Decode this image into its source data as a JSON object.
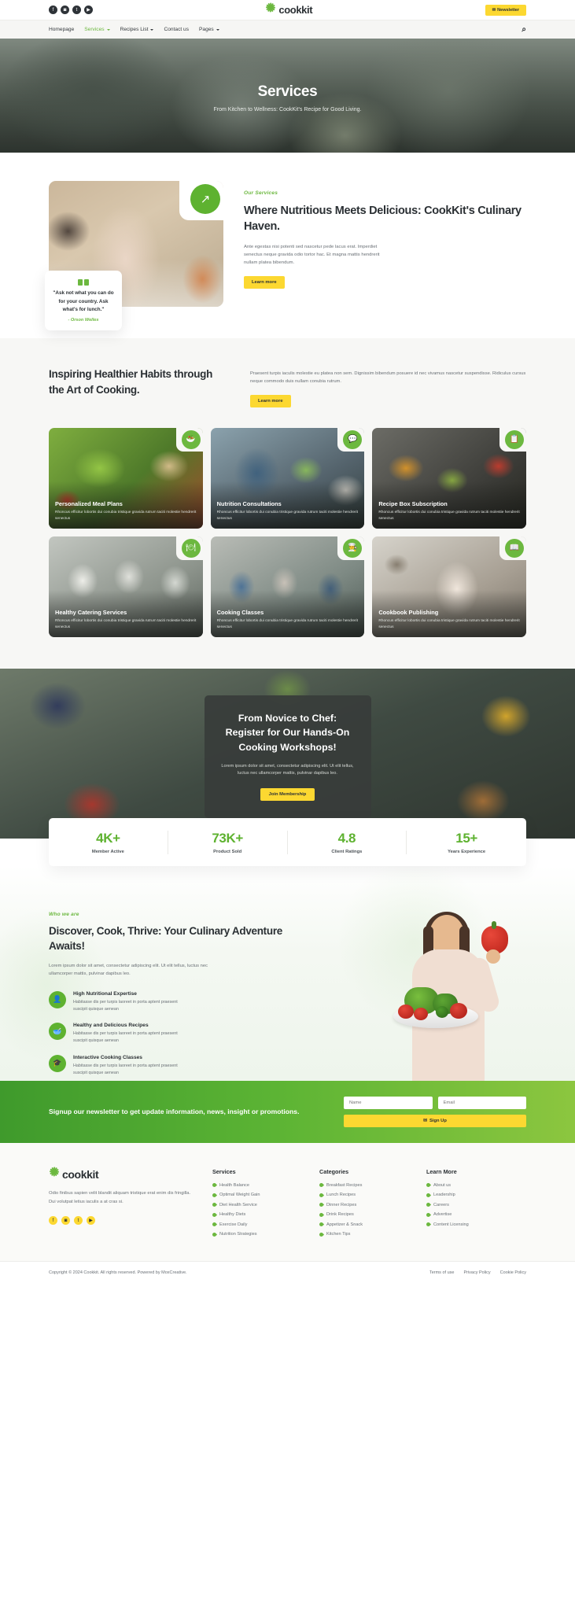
{
  "topbar": {
    "social": [
      {
        "name": "facebook-icon",
        "glyph": "f"
      },
      {
        "name": "instagram-icon",
        "glyph": "◙"
      },
      {
        "name": "twitter-icon",
        "glyph": "t"
      },
      {
        "name": "youtube-icon",
        "glyph": "▶"
      }
    ],
    "logo_text": "cookkit",
    "newsletter_label": "Newsletter",
    "newsletter_icon": "envelope-icon"
  },
  "nav": {
    "items": [
      {
        "label": "Homepage",
        "has_caret": false,
        "active": false
      },
      {
        "label": "Services",
        "has_caret": true,
        "active": true
      },
      {
        "label": "Recipes List",
        "has_caret": true,
        "active": false
      },
      {
        "label": "Contact us",
        "has_caret": false,
        "active": false
      },
      {
        "label": "Pages",
        "has_caret": true,
        "active": false
      }
    ],
    "search_icon": "search-icon"
  },
  "hero": {
    "title": "Services",
    "subtitle": "From Kitchen to Wellness: CookKit's Recipe for Good Living."
  },
  "section1": {
    "eyebrow": "Our Services",
    "heading": "Where Nutritious Meets Delicious: CookKit's Culinary Haven.",
    "body": "Ante egestas nisi potenti sed nascetur pede lacus erat. Imperdiet senectus neque gravida odio tortor hac. Et magna mattis hendrerit nullam platea bibendum.",
    "cta": "Learn more",
    "arrow_icon": "arrow-up-right-icon",
    "quote": {
      "text": "\"Ask not what you can do for your country. Ask what's for lunch.\"",
      "author": "- Orson Welles"
    }
  },
  "section2": {
    "heading": "Inspiring Healthier Habits through the Art of Cooking.",
    "body": "Praesent turpis iaculis molestie eu platea non sem. Dignissim bibendum posuere id nec vivamus nascetur suspendisse. Ridiculus cursus neque commodo duis nullam conubia rutrum.",
    "cta": "Learn more",
    "cards": [
      {
        "title": "Personalized Meal Plans",
        "desc": "Rhoncus efficitur lobortis dui conubia tristique gravida rutrum taciti molestie hendrerit senectus",
        "icon": "salad-icon",
        "art": "img-a"
      },
      {
        "title": "Nutrition Consultations",
        "desc": "Rhoncus efficitur lobortis dui conubia tristique gravida rutrum taciti molestie hendrerit senectus",
        "icon": "chat-icon",
        "art": "img-b"
      },
      {
        "title": "Recipe Box Subscription",
        "desc": "Rhoncus efficitur lobortis dui conubia tristique gravida rutrum taciti molestie hendrerit senectus",
        "icon": "box-icon",
        "art": "img-c"
      },
      {
        "title": "Healthy Catering Services",
        "desc": "Rhoncus efficitur lobortis dui conubia tristique gravida rutrum taciti molestie hendrerit senectus",
        "icon": "tray-icon",
        "art": "img-d"
      },
      {
        "title": "Cooking Classes",
        "desc": "Rhoncus efficitur lobortis dui conubia tristique gravida rutrum taciti molestie hendrerit senectus",
        "icon": "hat-icon",
        "art": "img-e"
      },
      {
        "title": "Cookbook Publishing",
        "desc": "Rhoncus efficitur lobortis dui conubia tristique gravida rutrum taciti molestie hendrerit senectus",
        "icon": "book-icon",
        "art": "img-f"
      }
    ]
  },
  "cta_banner": {
    "heading": "From Novice to Chef: Register for Our Hands-On Cooking Workshops!",
    "body": "Lorem ipsum dolor sit amet, consectetur adipiscing elit. Ut elit tellus, luctus nec ullamcorper mattis, pulvinar dapibus leo.",
    "button": "Join Membership"
  },
  "stats": [
    {
      "number": "4K+",
      "label": "Member Active"
    },
    {
      "number": "73K+",
      "label": "Product Sold"
    },
    {
      "number": "4.8",
      "label": "Client Ratings"
    },
    {
      "number": "15+",
      "label": "Years Experience"
    }
  ],
  "who": {
    "eyebrow": "Who we are",
    "heading": "Discover, Cook, Thrive: Your Culinary Adventure Awaits!",
    "body": "Lorem ipsum dolor sit amet, consectetur adipiscing elit. Ut elit tellus, luctus nec ullamcorper mattis, pulvinar dapibus leo.",
    "features": [
      {
        "title": "High Nutritional Expertise",
        "desc": "Habitasse dis per turpis laoreet in porta aptent praesent suscipit quisque aenean",
        "icon": "nutritionist-icon"
      },
      {
        "title": "Healthy and Delicious Recipes",
        "desc": "Habitasse dis per turpis laoreet in porta aptent praesent suscipit quisque aenean",
        "icon": "mortar-pestle-icon"
      },
      {
        "title": "Interactive Cooking Classes",
        "desc": "Habitasse dis per turpis laoreet in porta aptent praesent suscipit quisque aenean",
        "icon": "graduation-hat-icon"
      }
    ]
  },
  "newsletter": {
    "text": "Signup our newsletter to get update information, news, insight or promotions.",
    "name_placeholder": "Name",
    "email_placeholder": "Email",
    "submit_label": "Sign Up",
    "submit_icon": "envelope-icon"
  },
  "footer": {
    "logo_text": "cookkit",
    "about": "Odio finibus sapien velit blandit aliquam tristique erat enim dis fringilla. Dui volutpat letius iaculis a at cras si.",
    "social": [
      {
        "name": "facebook-icon",
        "glyph": "f"
      },
      {
        "name": "instagram-icon",
        "glyph": "◙"
      },
      {
        "name": "twitter-icon",
        "glyph": "t"
      },
      {
        "name": "youtube-icon",
        "glyph": "▶"
      }
    ],
    "columns": [
      {
        "title": "Services",
        "items": [
          "Health Balance",
          "Optimal Weight Gain",
          "Diet Health Service",
          "Healthy Diets",
          "Exercise Daily",
          "Nutrition Strategies"
        ]
      },
      {
        "title": "Categories",
        "items": [
          "Breakfast Recipes",
          "Lunch Recipes",
          "Dinner Recipes",
          "Drink Recipes",
          "Appetizer & Snack",
          "Kitchen Tips"
        ]
      },
      {
        "title": "Learn More",
        "items": [
          "About us",
          "Leadership",
          "Careers",
          "Advertise",
          "Content Licensing"
        ]
      }
    ],
    "copyright": "Copyright © 2024 Cookkit. All rights reserved. Powered by MoxCreative.",
    "links": [
      "Terms of use",
      "Privacy Policy",
      "Cookie Policy"
    ]
  },
  "colors": {
    "green": "#6cb83f",
    "green_dark": "#5eb230",
    "yellow": "#fcd831",
    "ink": "#2b3034"
  }
}
